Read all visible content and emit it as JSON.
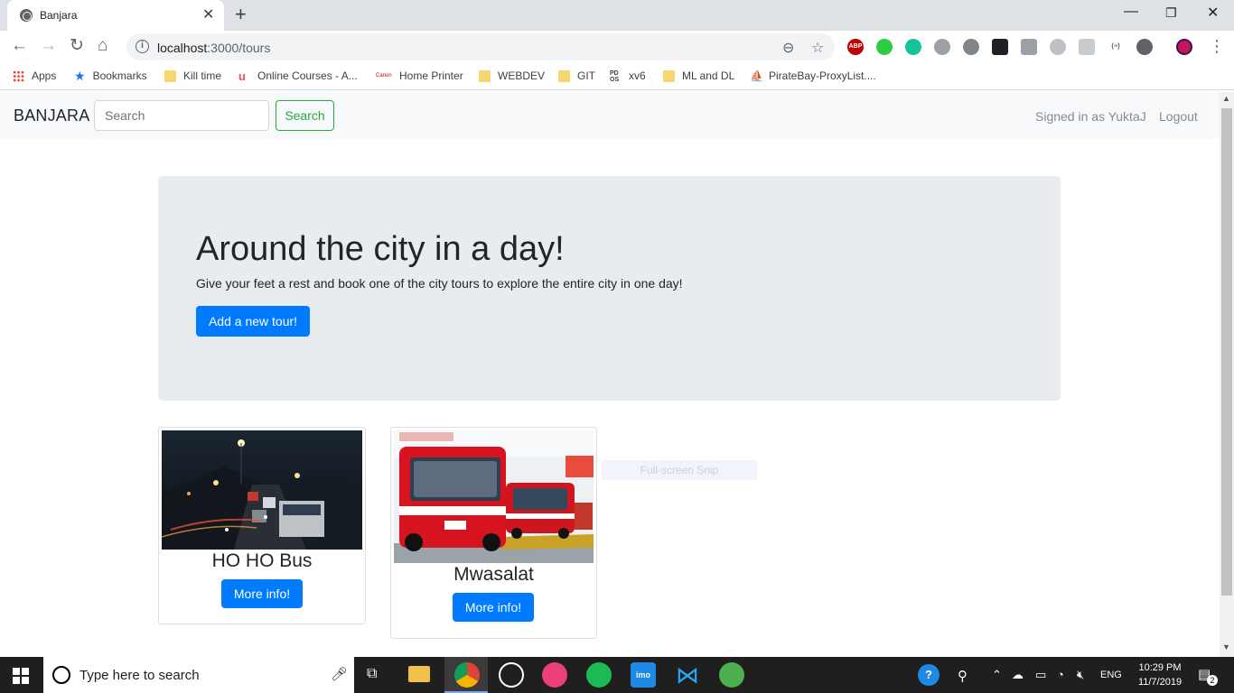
{
  "browser": {
    "tab_title": "Banjara",
    "url_host": "localhost",
    "url_path": ":3000/tours",
    "bookmarks": [
      "Apps",
      "Bookmarks",
      "Kill time",
      "Online Courses - A...",
      "Home Printer",
      "WEBDEV",
      "GIT",
      "xv6",
      "ML and DL",
      "PirateBay-ProxyList...."
    ],
    "extensions": [
      "ABP"
    ]
  },
  "navbar": {
    "brand": "BANJARA",
    "search_placeholder": "Search",
    "search_button": "Search",
    "signed_in": "Signed in as YuktaJ",
    "logout": "Logout"
  },
  "jumbotron": {
    "title": "Around the city in a day!",
    "text": "Give your feet a rest and book one of the city tours to explore the entire city in one day!",
    "button": "Add a new tour!"
  },
  "tours": [
    {
      "title": "HO HO Bus",
      "button": "More info!"
    },
    {
      "title": "Mwasalat",
      "button": "More info!"
    }
  ],
  "overlay": {
    "snip_label": "Full-screen Snip"
  },
  "taskbar": {
    "search_text": "Type here to search",
    "language": "ENG",
    "time": "10:29 PM",
    "date": "11/7/2019",
    "notifications": "2"
  },
  "colors": {
    "primary": "#007bff",
    "success": "#28a745",
    "jumbotron_bg": "#e9ecef",
    "navbar_bg": "#f8f9fa"
  }
}
